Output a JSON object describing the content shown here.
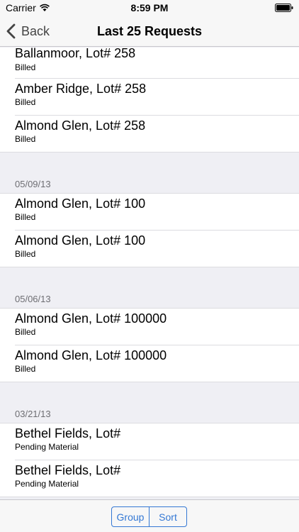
{
  "status_bar": {
    "carrier": "Carrier",
    "time": "8:59 PM"
  },
  "nav": {
    "back_label": "Back",
    "title": "Last 25 Requests"
  },
  "sections": [
    {
      "date": "",
      "items": [
        {
          "title": "Ballanmoor, Lot# 258",
          "status": "Billed"
        },
        {
          "title": "Amber Ridge, Lot# 258",
          "status": "Billed"
        },
        {
          "title": "Almond Glen, Lot# 258",
          "status": "Billed"
        }
      ]
    },
    {
      "date": "05/09/13",
      "items": [
        {
          "title": "Almond Glen, Lot# 100",
          "status": "Billed"
        },
        {
          "title": "Almond Glen, Lot# 100",
          "status": "Billed"
        }
      ]
    },
    {
      "date": "05/06/13",
      "items": [
        {
          "title": "Almond Glen, Lot# 100000",
          "status": "Billed"
        },
        {
          "title": "Almond Glen, Lot# 100000",
          "status": "Billed"
        }
      ]
    },
    {
      "date": "03/21/13",
      "items": [
        {
          "title": "Bethel Fields, Lot#",
          "status": "Pending Material"
        },
        {
          "title": "Bethel Fields, Lot#",
          "status": "Pending Material"
        }
      ]
    }
  ],
  "toolbar": {
    "group_label": "Group",
    "sort_label": "Sort"
  },
  "colors": {
    "accent": "#3478d4",
    "background": "#efeff4"
  }
}
